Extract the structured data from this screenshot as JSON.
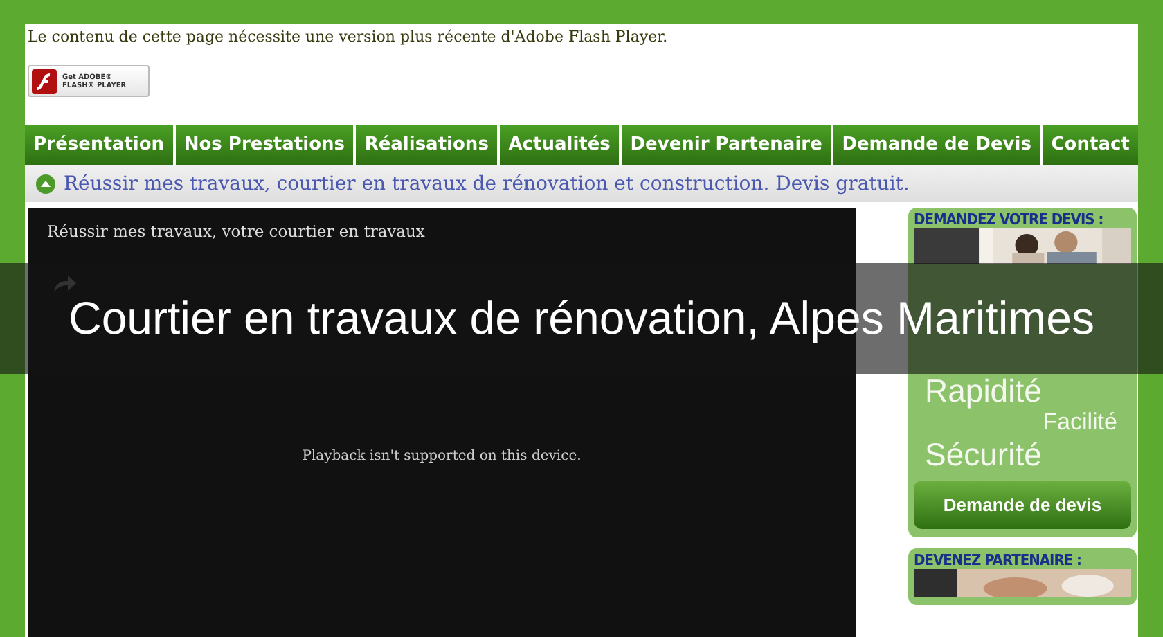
{
  "flash_notice": {
    "text": "Le contenu de cette page nécessite une version plus récente d'Adobe Flash Player.",
    "badge_top": "Get ADOBE®",
    "badge_bottom": "FLASH® PLAYER"
  },
  "nav": {
    "items": [
      {
        "label": "Présentation",
        "selected": false
      },
      {
        "label": "Nos Prestations",
        "selected": false
      },
      {
        "label": "Réalisations",
        "selected": false
      },
      {
        "label": "Actualités",
        "selected": false
      },
      {
        "label": "Devenir Partenaire",
        "selected": false
      },
      {
        "label": "Demande de Devis",
        "selected": false
      },
      {
        "label": "Contact",
        "selected": false
      }
    ]
  },
  "breadcrumb": "Réussir mes travaux, courtier en travaux de rénovation et construction. Devis gratuit.",
  "video": {
    "title": "Réussir mes travaux, votre courtier en travaux",
    "message": "Playback isn't supported on this device."
  },
  "sidebar": {
    "quote_heading": "DEMANDEZ VOTRE DEVIS :",
    "words": [
      {
        "text": "Rapidité",
        "kind": "large"
      },
      {
        "text": "Facilité",
        "kind": "small"
      },
      {
        "text": "Sécurité",
        "kind": "large"
      }
    ],
    "quote_button": "Demande de devis",
    "partner_heading": "DEVENEZ PARTENAIRE :"
  },
  "overlay_title": "Courtier en travaux de rénovation, Alpes Maritimes"
}
